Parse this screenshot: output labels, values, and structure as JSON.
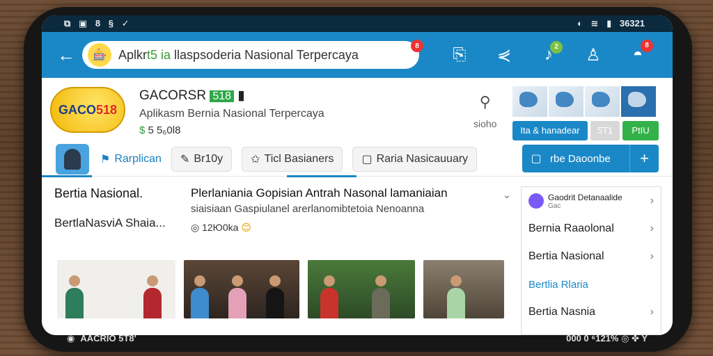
{
  "status_bar": {
    "left_icons": [
      "⧉",
      "▣",
      "8",
      "§",
      "✓"
    ],
    "right_text": "36321",
    "right_icons": [
      "◐",
      "≋",
      "▮"
    ]
  },
  "app_bar": {
    "search_text_prefix": "Aplkr",
    "search_text_green": "t5 ia",
    "search_text_rest": " llaspsoderia Nasional Terpercaya",
    "search_badge": "8",
    "icons": [
      "save-icon",
      "share-icon",
      "bell-icon",
      "user-icon",
      "chat-icon"
    ],
    "bell_badge": "2",
    "chat_badge": "8"
  },
  "header": {
    "brand_blue": "GACO",
    "brand_red": "518",
    "title": "GACORSR",
    "title_tag": "518",
    "subtitle": "Aplikasm Bernia Nasional Terpercaya",
    "meta": "5 5₆0l8",
    "side_label": "sioho",
    "chips": [
      "Ita & hanadear",
      "5T1",
      "PtIU"
    ]
  },
  "tabs": [
    {
      "label": "Rarplican",
      "icon": "⚑",
      "active": true
    },
    {
      "label": "Br10y",
      "icon": "✎",
      "active": false
    },
    {
      "label": "Ticl Basianers",
      "icon": "✩",
      "active": false
    },
    {
      "label": "Raria Nasicauuary",
      "icon": "▢",
      "active": false
    }
  ],
  "cta": {
    "label": "rbe Daoonbe",
    "plus": "+"
  },
  "news": {
    "left_title": "Bertia Nasional.",
    "left_sub": "BertlaNasviA Shaia...",
    "headline": "Plerlaniania Gopisian Antrah Nasonal lamaniaian",
    "desc": "siaisiaan Gaspiulanel arerlanomibtetoia Nenoanna",
    "views": "12Ю0ka"
  },
  "right_list": [
    {
      "label": "Gaodrit Detanaalide",
      "sub": "Gac",
      "type": "first"
    },
    {
      "label": "Bernia Raaolonal",
      "type": "normal"
    },
    {
      "label": "Bertia Nasional",
      "type": "normal"
    },
    {
      "label": "Bertlia Rlaria",
      "type": "blue"
    },
    {
      "label": "Bertia Nasnia",
      "type": "normal"
    }
  ],
  "nav_bar": {
    "left": "AACRIO 5T8'",
    "right": "000 0 ⁶121% ◎ ✤ Y"
  },
  "colors": {
    "primary": "#1a88c6",
    "green": "#33b24a",
    "badge": "#e33333"
  }
}
